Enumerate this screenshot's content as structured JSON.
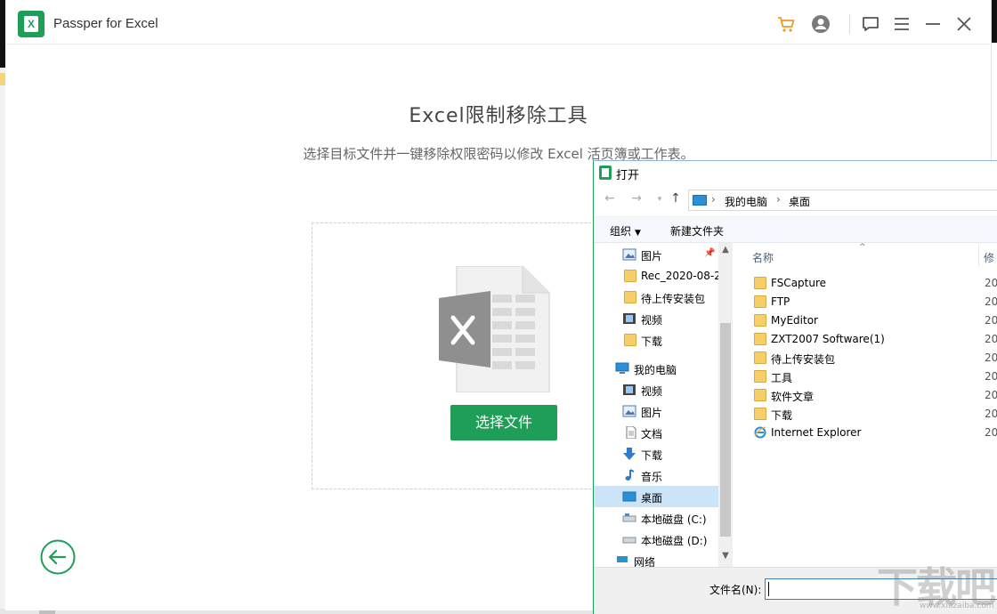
{
  "app": {
    "title": "Passper for Excel",
    "heading": "Excel限制移除工具",
    "subtitle": "选择目标文件并一键移除权限密码以修改 Excel 活页簿或工作表。",
    "select_button": "选择文件",
    "logo_letter": "X",
    "accent_color": "#1e9e57",
    "toolbar_icons": [
      "cart-icon",
      "user-icon",
      "feedback-icon",
      "menu-icon",
      "minimize-icon",
      "close-icon"
    ]
  },
  "dialog": {
    "title": "打开",
    "breadcrumb": [
      "我的电脑",
      "桌面"
    ],
    "commands": {
      "organize": "组织",
      "new_folder": "新建文件夹"
    },
    "nav_items": [
      {
        "label": "图片",
        "icon": "pictures-icon"
      },
      {
        "label": "Rec_2020-08-2",
        "icon": "folder-icon"
      },
      {
        "label": "待上传安装包",
        "icon": "folder-icon"
      },
      {
        "label": "视频",
        "icon": "video-icon"
      },
      {
        "label": "下载",
        "icon": "folder-icon"
      },
      {
        "label": "我的电脑",
        "icon": "computer-icon"
      },
      {
        "label": "视频",
        "icon": "video-icon"
      },
      {
        "label": "图片",
        "icon": "pictures-icon"
      },
      {
        "label": "文档",
        "icon": "document-icon"
      },
      {
        "label": "下载",
        "icon": "download-icon"
      },
      {
        "label": "音乐",
        "icon": "music-icon"
      },
      {
        "label": "桌面",
        "icon": "desktop-icon",
        "selected": true
      },
      {
        "label": "本地磁盘 (C:)",
        "icon": "drive-icon"
      },
      {
        "label": "本地磁盘 (D:)",
        "icon": "drive-icon"
      },
      {
        "label": "网络",
        "icon": "network-icon"
      }
    ],
    "columns": {
      "name": "名称",
      "modified": "修"
    },
    "files": [
      {
        "name": "FSCapture",
        "date": "20"
      },
      {
        "name": "FTP",
        "date": "20"
      },
      {
        "name": "MyEditor",
        "date": "20"
      },
      {
        "name": "ZXT2007 Software(1)",
        "date": "20"
      },
      {
        "name": "待上传安装包",
        "date": "20"
      },
      {
        "name": "工具",
        "date": "20"
      },
      {
        "name": "软件文章",
        "date": "20"
      },
      {
        "name": "下载",
        "date": "20"
      },
      {
        "name": "Internet  Explorer",
        "date": "20",
        "icon": "ie-icon"
      }
    ],
    "filename_label": "文件名(N):",
    "filename_value": ""
  },
  "watermark": {
    "text": "下载吧",
    "sub": "www.xiazaiba.com"
  }
}
